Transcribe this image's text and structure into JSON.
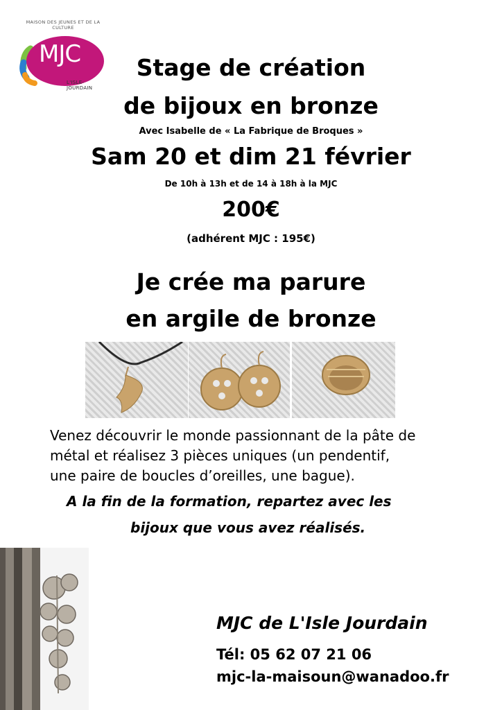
{
  "logo": {
    "text": "MJC",
    "arc_text": "MAISON DES JEUNES ET DE LA CULTURE",
    "subtitle": "L'ISLE-JOURDAIN"
  },
  "title": {
    "line1": "Stage de création",
    "line2": "de bijoux en bronze"
  },
  "with": "Avec Isabelle de « La Fabrique de Broques »",
  "dates": "Sam 20 et dim 21 février",
  "hours": "De 10h à 13h et de 14 à 18h à la MJC",
  "price": "200€",
  "member_price": "(adhérent MJC : 195€)",
  "subtitle": {
    "line1": "Je crée ma parure",
    "line2": "en argile de bronze"
  },
  "description": {
    "lines": [
      "Venez découvrir le monde passionnant de la pâte de",
      "métal et réalisez 3 pièces uniques  (un pendentif,",
      "une paire de boucles d’oreilles, une bague)."
    ],
    "italic_line1": "A la fin de la formation, repartez avec les",
    "italic_line2": "bijoux que vous avez réalisés."
  },
  "contact": {
    "organization": "MJC de L'Isle Jourdain",
    "phone": "Tél: 05 62 07 21 06",
    "email": "mjc-la-maisoun@wanadoo.fr"
  },
  "colors": {
    "logo_magenta": "#c2177a",
    "logo_blue": "#2a7fd0",
    "logo_green": "#7cc242",
    "logo_orange": "#f29a1f"
  }
}
